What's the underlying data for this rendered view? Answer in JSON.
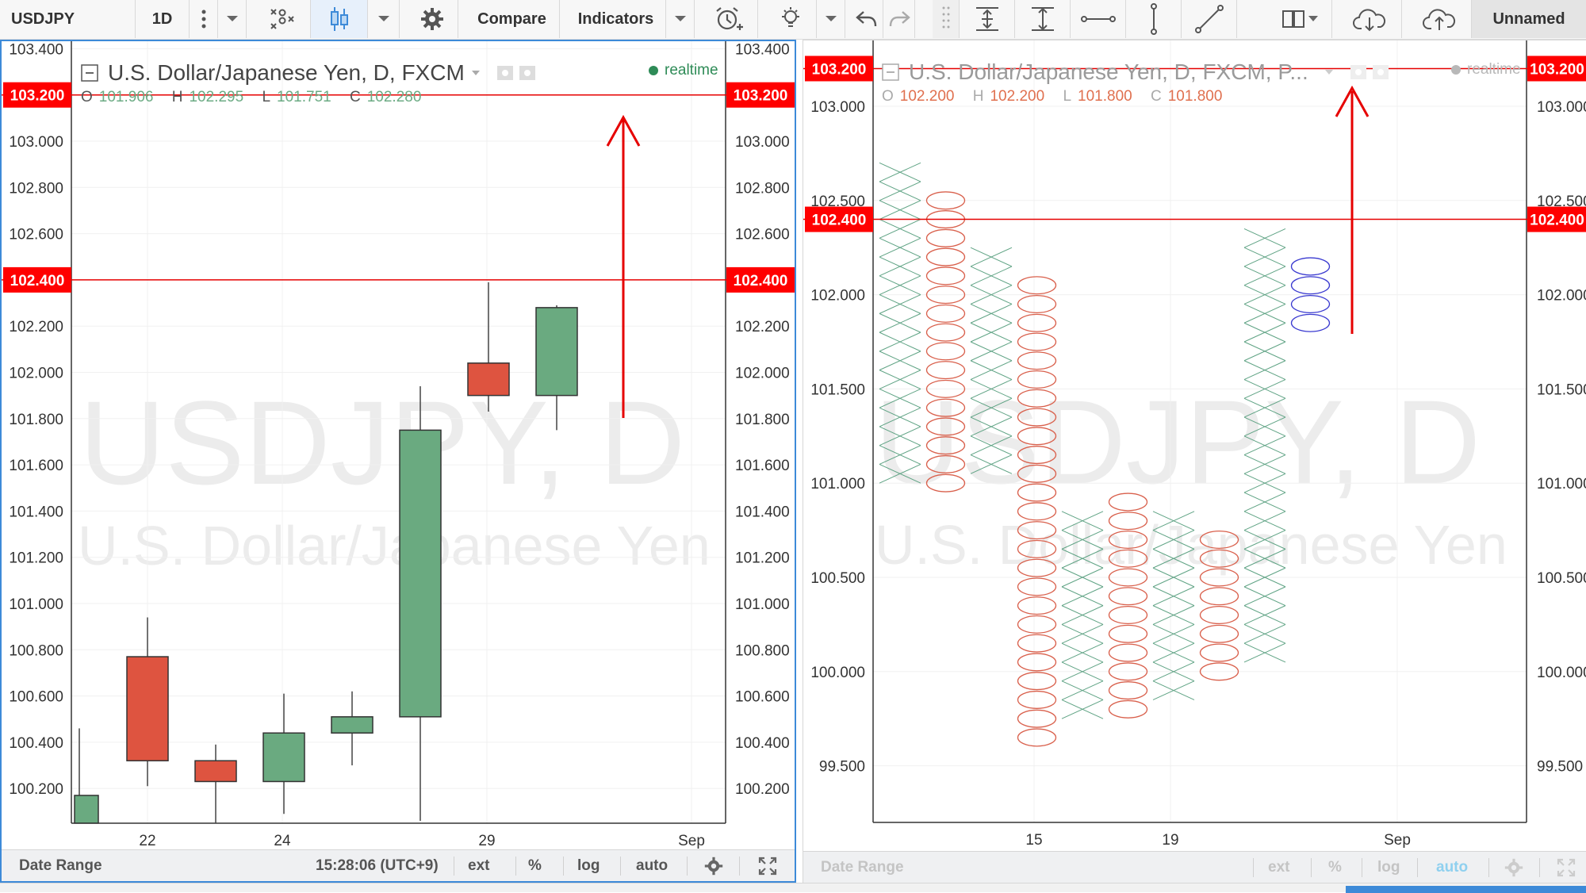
{
  "toolbar": {
    "symbol": "USDJPY",
    "interval": "1D",
    "compare_label": "Compare",
    "indicators_label": "Indicators",
    "layout_name": "Unnamed"
  },
  "left_chart": {
    "title": "U.S. Dollar/Japanese Yen, D, FXCM",
    "status": "realtime",
    "ohlc": {
      "o_label": "O",
      "o": "101.906",
      "h_label": "H",
      "h": "102.295",
      "l_label": "L",
      "l": "101.751",
      "c_label": "C",
      "c": "102.280"
    },
    "watermark_symbol": "USDJPY, D",
    "watermark_name": "U.S. Dollar/Japanese Yen",
    "price_ticks": [
      "103.400",
      "103.000",
      "102.800",
      "102.600",
      "102.200",
      "102.000",
      "101.800",
      "101.600",
      "101.400",
      "101.200",
      "101.000",
      "100.800",
      "100.600",
      "100.400",
      "100.200"
    ],
    "x_ticks": [
      "22",
      "24",
      "29",
      "Sep"
    ],
    "horizontal_lines": [
      {
        "value": 103.2,
        "label": "103.200"
      },
      {
        "value": 102.4,
        "label": "102.400"
      }
    ],
    "candles": [
      {
        "open": 100.05,
        "high": 100.46,
        "low": 100.05,
        "close": 100.17,
        "dir": "up"
      },
      {
        "open": 100.77,
        "high": 100.94,
        "low": 100.21,
        "close": 100.32,
        "dir": "down"
      },
      {
        "open": 100.32,
        "high": 100.39,
        "low": 100.05,
        "close": 100.23,
        "dir": "down"
      },
      {
        "open": 100.23,
        "high": 100.61,
        "low": 100.09,
        "close": 100.44,
        "dir": "up"
      },
      {
        "open": 100.44,
        "high": 100.62,
        "low": 100.3,
        "close": 100.51,
        "dir": "up"
      },
      {
        "open": 100.51,
        "high": 101.94,
        "low": 100.06,
        "close": 101.75,
        "dir": "up"
      },
      {
        "open": 102.04,
        "high": 102.39,
        "low": 101.83,
        "close": 101.9,
        "dir": "down"
      },
      {
        "open": 101.9,
        "high": 102.29,
        "low": 101.75,
        "close": 102.28,
        "dir": "up"
      }
    ],
    "bottom_bar": {
      "date_range": "Date Range",
      "time": "15:28:06 (UTC+9)",
      "ext": "ext",
      "pct": "%",
      "log": "log",
      "auto": "auto"
    }
  },
  "right_chart": {
    "title": "U.S. Dollar/Japanese Yen, D, FXCM, P...",
    "status": "realtime",
    "ohlc": {
      "o_label": "O",
      "o": "102.200",
      "h_label": "H",
      "h": "102.200",
      "l_label": "L",
      "l": "101.800",
      "c_label": "C",
      "c": "101.800"
    },
    "watermark_symbol": "USDJPY, D",
    "watermark_name": "U.S. Dollar/Japanese Yen",
    "price_ticks": [
      "103.000",
      "102.500",
      "102.000",
      "101.500",
      "101.000",
      "100.500",
      "100.000",
      "99.500"
    ],
    "right_price_ticks": [
      "103.000",
      "102.500",
      "102.000",
      "101.500",
      "101.000",
      "100.500",
      "100.000",
      "99.500"
    ],
    "x_ticks": [
      "15",
      "19",
      "Sep"
    ],
    "horizontal_lines": [
      {
        "value": 103.2,
        "label": "103.200"
      },
      {
        "value": 102.4,
        "label": "102.400"
      }
    ],
    "pnf_columns": [
      {
        "type": "X",
        "low": 101.0,
        "high": 102.7
      },
      {
        "type": "O",
        "low": 100.95,
        "high": 102.55
      },
      {
        "type": "X",
        "low": 101.05,
        "high": 102.25
      },
      {
        "type": "O",
        "low": 99.6,
        "high": 102.1
      },
      {
        "type": "X",
        "low": 99.7,
        "high": 100.85
      },
      {
        "type": "O",
        "low": 99.75,
        "high": 100.95
      },
      {
        "type": "X",
        "low": 99.8,
        "high": 100.85
      },
      {
        "type": "O",
        "low": 100.0,
        "high": 100.75
      },
      {
        "type": "X",
        "low": 100.05,
        "high": 102.35
      },
      {
        "type": "O",
        "low": 101.8,
        "high": 102.2,
        "highlight": true
      }
    ],
    "bottom_bar": {
      "date_range": "Date Range",
      "ext": "ext",
      "pct": "%",
      "log": "log",
      "auto": "auto"
    }
  },
  "colors": {
    "up_candle": "#6aaa80",
    "down_candle": "#de5440",
    "x_mark": "#5fa384",
    "o_mark": "#d9604c",
    "o_highlight": "#3a3ad0",
    "hline": "#e60000",
    "label_bg": "#ff0000",
    "arrow": "#e60000",
    "accent": "#3d8ad8"
  }
}
